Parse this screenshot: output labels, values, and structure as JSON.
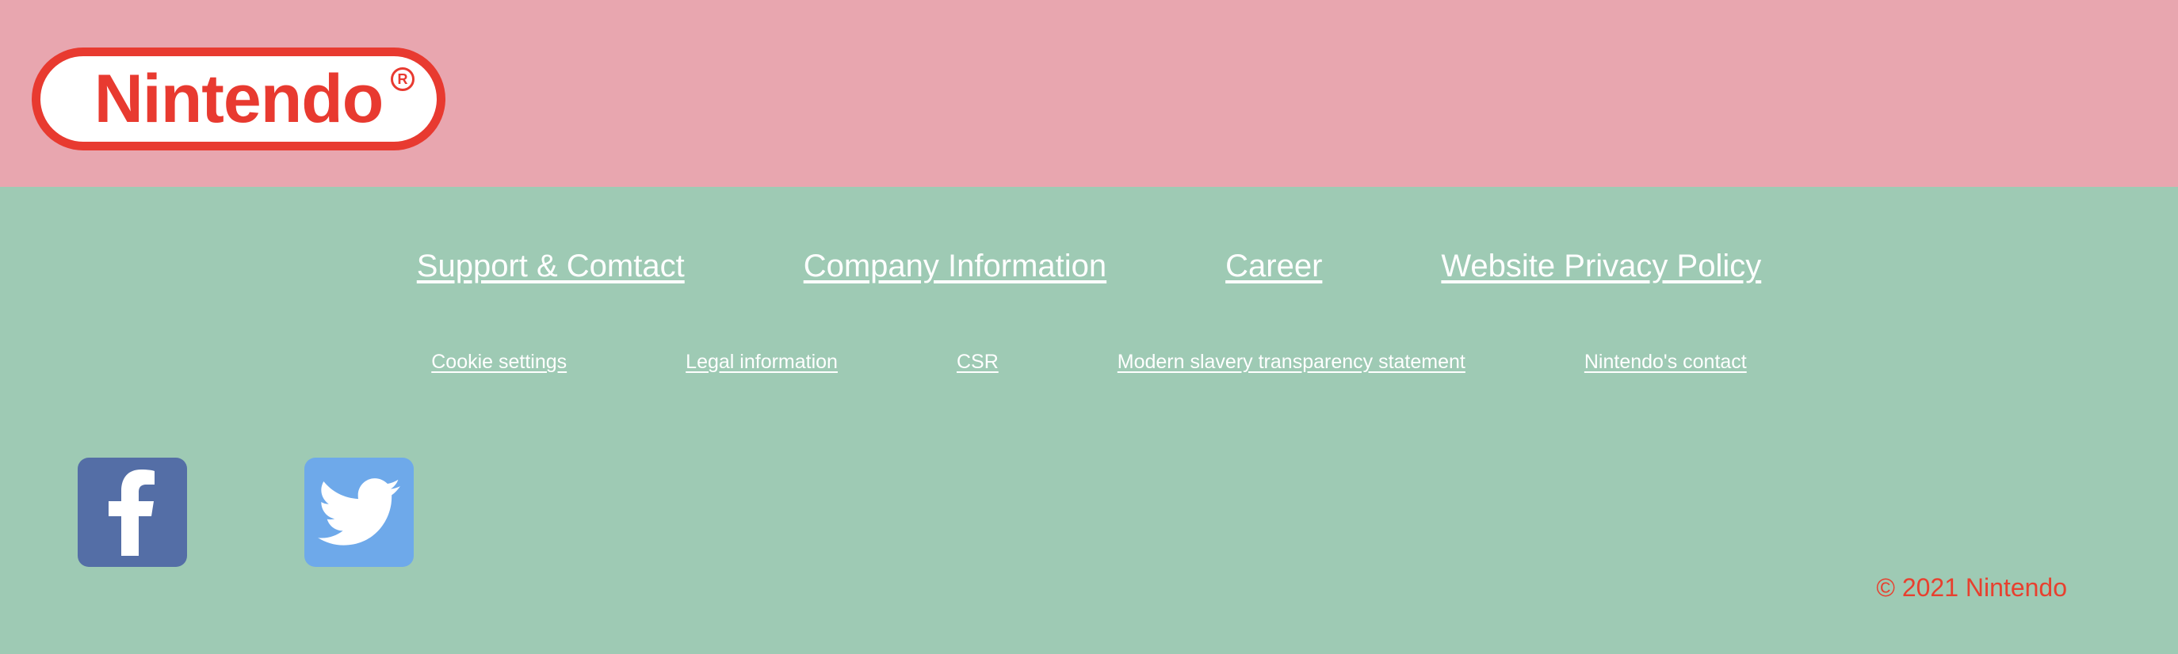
{
  "header": {
    "logo_text": "Nintendo",
    "logo_registered_mark": "R",
    "colors": {
      "background": "#e8a6af",
      "logo_red": "#e83a30"
    }
  },
  "footer": {
    "primary_links": [
      {
        "label": "Support & Comtact"
      },
      {
        "label": "Company Information"
      },
      {
        "label": "Career"
      },
      {
        "label": "Website Privacy Policy"
      }
    ],
    "secondary_links": [
      {
        "label": "Cookie settings"
      },
      {
        "label": "Legal information"
      },
      {
        "label": "CSR"
      },
      {
        "label": "Modern slavery transparency statement"
      },
      {
        "label": "Nintendo's contact"
      }
    ],
    "social": [
      {
        "icon": "facebook-icon",
        "color": "#546ea6"
      },
      {
        "icon": "twitter-icon",
        "color": "#6ea9ea"
      }
    ],
    "copyright": "© 2021 Nintendo",
    "colors": {
      "background": "#9ecab4",
      "copyright": "#e8402f",
      "link": "#ffffff"
    }
  }
}
